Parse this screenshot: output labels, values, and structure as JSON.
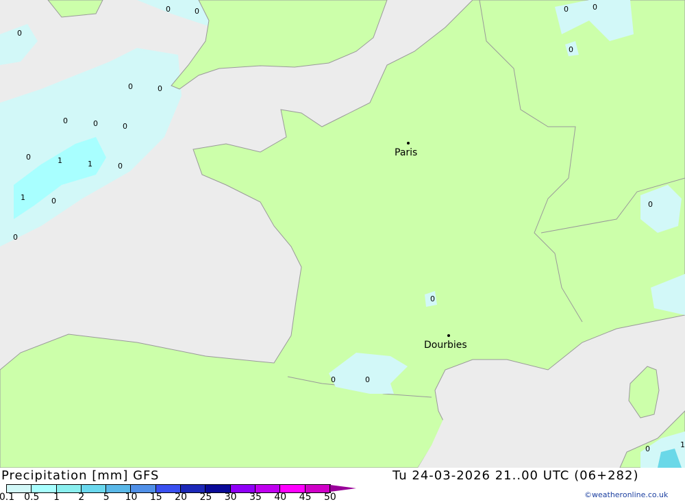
{
  "title": "Precipitation [mm] GFS",
  "datetime": "Tu 24-03-2026 21..00 UTC (06+282)",
  "copyright": "©weatheronline.co.uk",
  "colors": {
    "sea": "#ececec",
    "land": "#ccffaa",
    "precip_light": "#d2f8f8",
    "precip_mid": "#a8ffff",
    "precip_dark": "#6ad8e8",
    "border": "#999999"
  },
  "legend": {
    "ticks": [
      "0.1",
      "0.5",
      "1",
      "2",
      "5",
      "10",
      "15",
      "20",
      "25",
      "30",
      "35",
      "40",
      "45",
      "50"
    ],
    "colors": [
      "#d2f8f8",
      "#a8ffff",
      "#8aefef",
      "#6ad8ee",
      "#5ab8e8",
      "#5090e8",
      "#3a50f0",
      "#1c28b8",
      "#0a0a98",
      "#9000f8",
      "#c000f0",
      "#ff00ff",
      "#d000c8",
      "#990099"
    ]
  },
  "cities": [
    {
      "name": "Paris"
    },
    {
      "name": "Dourbies"
    }
  ],
  "values": [
    "0",
    "0",
    "0",
    "0",
    "0",
    "0",
    "0",
    "0",
    "0",
    "0",
    "1",
    "1",
    "0",
    "1",
    "0",
    "0",
    "0",
    "0",
    "0",
    "0",
    "0",
    "0",
    "0",
    "0",
    "1"
  ]
}
